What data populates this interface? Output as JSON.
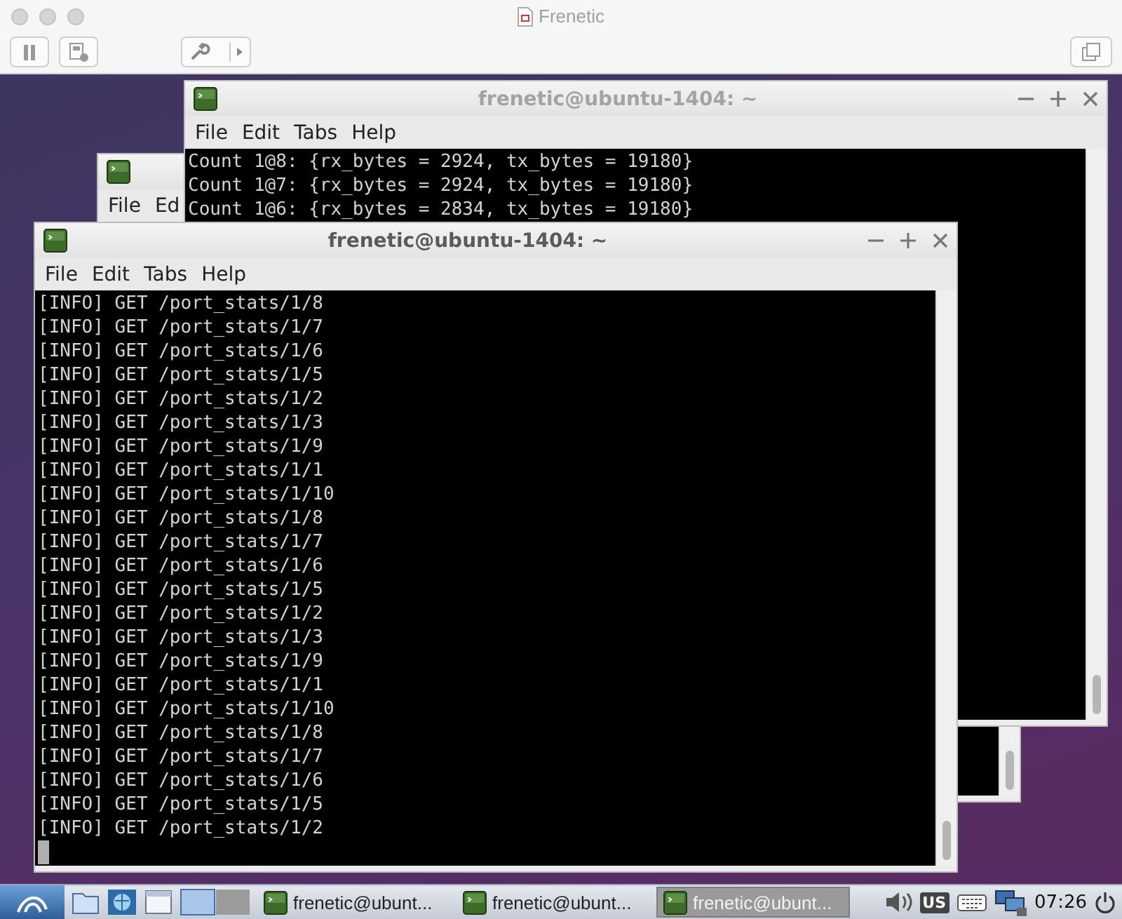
{
  "host": {
    "title": "Frenetic"
  },
  "windows": [
    {
      "menu": [
        "File",
        "Ed"
      ]
    },
    {
      "title": "frenetic@ubuntu-1404: ~",
      "active": false,
      "menu": [
        "File",
        "Edit",
        "Tabs",
        "Help"
      ],
      "lines": [
        "Count 1@8: {rx_bytes = 2924, tx_bytes = 19180}",
        "Count 1@7: {rx_bytes = 2924, tx_bytes = 19180}",
        "Count 1@6: {rx_bytes = 2834, tx_bytes = 19180}"
      ]
    },
    {
      "title": "frenetic@ubuntu-1404: ~",
      "active": true,
      "menu": [
        "File",
        "Edit",
        "Tabs",
        "Help"
      ],
      "lines": [
        "[INFO] GET /port_stats/1/8",
        "[INFO] GET /port_stats/1/7",
        "[INFO] GET /port_stats/1/6",
        "[INFO] GET /port_stats/1/5",
        "[INFO] GET /port_stats/1/2",
        "[INFO] GET /port_stats/1/3",
        "[INFO] GET /port_stats/1/9",
        "[INFO] GET /port_stats/1/1",
        "[INFO] GET /port_stats/1/10",
        "[INFO] GET /port_stats/1/8",
        "[INFO] GET /port_stats/1/7",
        "[INFO] GET /port_stats/1/6",
        "[INFO] GET /port_stats/1/5",
        "[INFO] GET /port_stats/1/2",
        "[INFO] GET /port_stats/1/3",
        "[INFO] GET /port_stats/1/9",
        "[INFO] GET /port_stats/1/1",
        "[INFO] GET /port_stats/1/10",
        "[INFO] GET /port_stats/1/8",
        "[INFO] GET /port_stats/1/7",
        "[INFO] GET /port_stats/1/6",
        "[INFO] GET /port_stats/1/5",
        "[INFO] GET /port_stats/1/2"
      ]
    }
  ],
  "taskbar": {
    "tasks": [
      {
        "label": "frenetic@ubunt...",
        "selected": false
      },
      {
        "label": "frenetic@ubunt...",
        "selected": false
      },
      {
        "label": "frenetic@ubunt...",
        "selected": true
      }
    ],
    "keyboard_layout": "US",
    "clock": "07:26"
  }
}
